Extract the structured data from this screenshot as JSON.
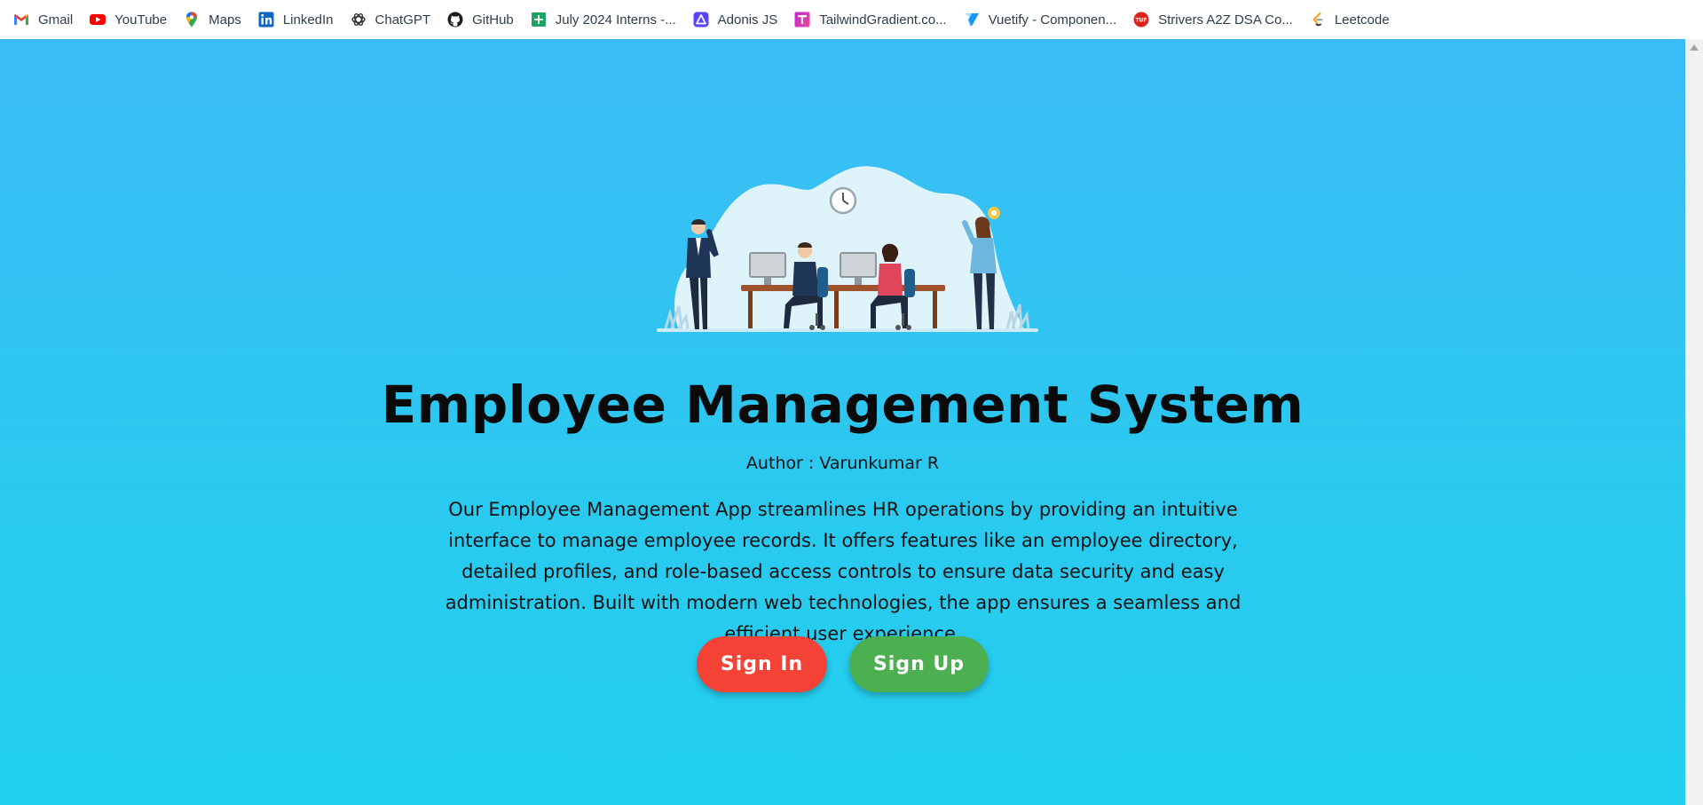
{
  "bookmarks": [
    {
      "label": "Gmail",
      "icon": "gmail-icon"
    },
    {
      "label": "YouTube",
      "icon": "youtube-icon"
    },
    {
      "label": "Maps",
      "icon": "maps-pin-icon"
    },
    {
      "label": "LinkedIn",
      "icon": "linkedin-icon"
    },
    {
      "label": "ChatGPT",
      "icon": "chatgpt-icon"
    },
    {
      "label": "GitHub",
      "icon": "github-icon"
    },
    {
      "label": "July 2024 Interns -...",
      "icon": "google-sheets-icon"
    },
    {
      "label": "Adonis JS",
      "icon": "adonisjs-icon"
    },
    {
      "label": "TailwindGradient.co...",
      "icon": "tailwindgradient-icon"
    },
    {
      "label": "Vuetify - Componen...",
      "icon": "vuetify-icon"
    },
    {
      "label": "Strivers A2Z DSA Co...",
      "icon": "takeuforward-icon"
    },
    {
      "label": "Leetcode",
      "icon": "leetcode-icon"
    }
  ],
  "hero": {
    "title": "Employee Management System",
    "author": "Author : Varunkumar R",
    "description": "Our Employee Management App streamlines HR operations by providing an intuitive interface to manage employee records. It offers features like an employee directory, detailed profiles, and role-based access controls to ensure data security and easy administration. Built with modern web technologies, the app ensures a seamless and efficient user experience.",
    "illustration": "office-team-illustration"
  },
  "actions": {
    "sign_in": "Sign In",
    "sign_up": "Sign Up"
  },
  "colors": {
    "background_top": "#3bbcf7",
    "background_bottom": "#22d0ee",
    "sign_in": "#f44336",
    "sign_up": "#4caf50"
  }
}
